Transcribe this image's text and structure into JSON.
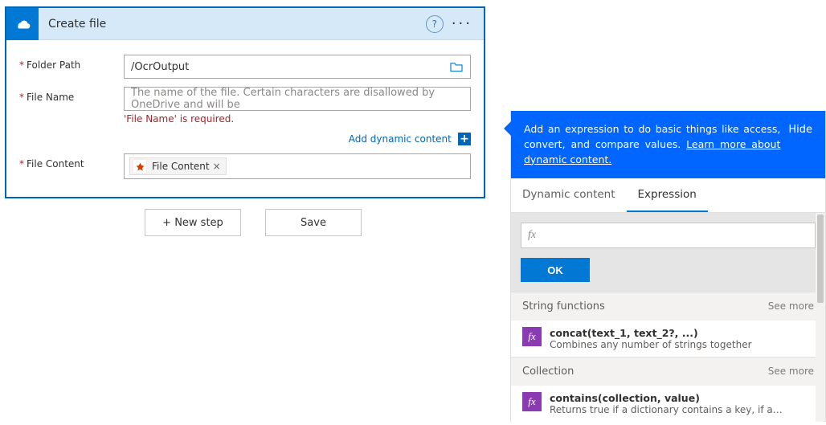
{
  "card": {
    "title": "Create file",
    "fields": {
      "folderPath": {
        "label": "Folder Path",
        "value": "/OcrOutput"
      },
      "fileName": {
        "label": "File Name",
        "placeholder": "The name of the file. Certain characters are disallowed by OneDrive and will be",
        "error": "'File Name' is required."
      },
      "fileContent": {
        "label": "File Content",
        "tokenLabel": "File Content",
        "tokenClose": "×"
      }
    },
    "dynamicContentLabel": "Add dynamic content",
    "help": "?",
    "more": "···"
  },
  "buttons": {
    "newStep": "+ New step",
    "save": "Save"
  },
  "panel": {
    "intro": "Add an expression to do basic things like access, convert, and compare values. ",
    "learnMore": "Learn more about dynamic content.",
    "hide": "Hide",
    "tabs": {
      "dynamic": "Dynamic content",
      "expression": "Expression"
    },
    "fxPlaceholder": "fx",
    "ok": "OK",
    "groups": [
      {
        "title": "String functions",
        "seeMore": "See more",
        "items": [
          {
            "name": "concat(text_1, text_2?, ...)",
            "desc": "Combines any number of strings together"
          }
        ]
      },
      {
        "title": "Collection",
        "seeMore": "See more",
        "items": [
          {
            "name": "contains(collection, value)",
            "desc": "Returns true if a dictionary contains a key, if an array cont..."
          }
        ]
      }
    ]
  }
}
